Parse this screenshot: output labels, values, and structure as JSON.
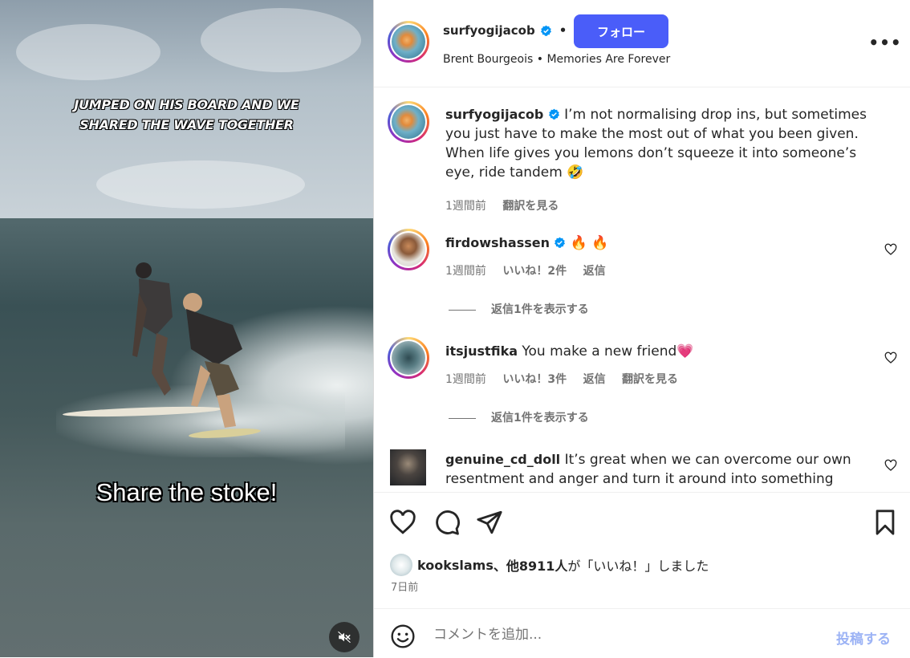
{
  "media": {
    "overlay_text": "JUMPED ON HIS BOARD AND WE SHARED THE WAVE TOGETHER",
    "caption_text": "Share the stoke!",
    "mute_icon": "muted-speaker-icon"
  },
  "header": {
    "username": "surfyogijacob",
    "separator": "•",
    "follow_label": "フォロー",
    "subtitle": "Brent Bourgeois • Memories Are Forever",
    "more_label": "•••"
  },
  "post_caption": {
    "username": "surfyogijacob",
    "text": "I’m not normalising drop ins, but sometimes you just have to make the most out of what you been given. When life gives you lemons don’t squeeze it into someone’s eye, ride tandem 🤣",
    "time": "1週間前",
    "translate": "翻訳を見る"
  },
  "comments": [
    {
      "username": "firdowshassen",
      "text": "🔥 🔥",
      "time": "1週間前",
      "likes": "いいね！2件",
      "reply": "返信",
      "view_replies": "返信1件を表示する"
    },
    {
      "username": "itsjustfika",
      "text": "You make a new friend💗",
      "time": "1週間前",
      "likes": "いいね！3件",
      "reply": "返信",
      "translate": "翻訳を見る",
      "view_replies": "返信1件を表示する"
    },
    {
      "username": "genuine_cd_doll",
      "text": "It’s great when we can overcome our own resentment and anger and turn it around into something"
    }
  ],
  "likes_line": {
    "user": "kookslams",
    "rest": "、他8911人",
    "suffix": "が「いいね！」しました"
  },
  "date": "7日前",
  "composer": {
    "placeholder": "コメントを追加...",
    "post_label": "投稿する"
  },
  "colors": {
    "follow_button": "#4a5df9",
    "verified": "#0095f6",
    "post_disabled": "#9cb3f5",
    "heart": "#ff3b5c"
  }
}
